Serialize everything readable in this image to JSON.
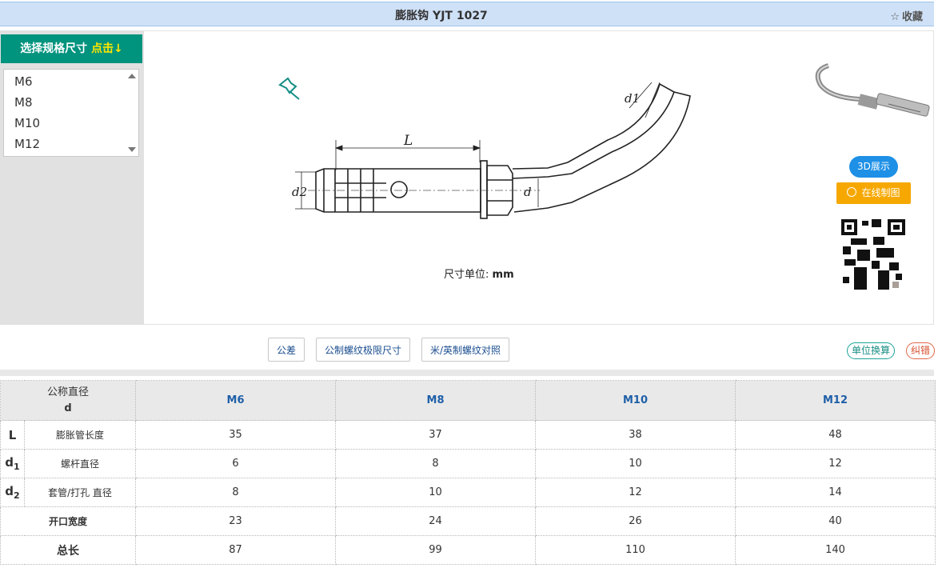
{
  "window": {
    "title": "膨胀钩 YJT 1027",
    "favorite_icon": "star-icon",
    "favorite_label": "收藏"
  },
  "sidebar": {
    "header_label": "选择规格尺寸",
    "header_highlight": "点击↓",
    "items": [
      "M6",
      "M8",
      "M10",
      "M12"
    ]
  },
  "figure": {
    "labels": {
      "L": "L",
      "d": "d",
      "d1": "d1",
      "d2": "d2"
    },
    "unit_caption_prefix": "尺寸单位:",
    "unit_caption_unit": "mm",
    "pin_icon": "pushpin-icon"
  },
  "right_panel": {
    "show3d_label": "3D展示",
    "online_draw_label": "在线制图",
    "online_draw_icon": "cad-icon"
  },
  "toolbar": {
    "tolerance_label": "公差",
    "thread_limits_label": "公制螺纹极限尺寸",
    "thread_compare_label": "米/英制螺纹对照",
    "unit_convert_label": "单位换算",
    "error_report_label": "纠错"
  },
  "table": {
    "header_name": "公称直径",
    "header_symbol": "d",
    "sizes": [
      "M6",
      "M8",
      "M10",
      "M12"
    ],
    "rows": [
      {
        "symbol": "L",
        "name": "膨胀管长度",
        "values": [
          "35",
          "37",
          "38",
          "48"
        ]
      },
      {
        "symbol": "d1",
        "name": "螺杆直径",
        "values": [
          "6",
          "8",
          "10",
          "12"
        ]
      },
      {
        "symbol": "d2",
        "name": "套管/打孔 直径",
        "values": [
          "8",
          "10",
          "12",
          "14"
        ]
      },
      {
        "symbol": "",
        "name": "开口宽度",
        "values": [
          "23",
          "24",
          "26",
          "40"
        ]
      },
      {
        "symbol": "",
        "name": "总长",
        "values": [
          "87",
          "99",
          "110",
          "140"
        ]
      }
    ]
  },
  "colors": {
    "title_bar": "#cfe1f7",
    "sidebar_header": "#00937e",
    "highlight": "#ffe600",
    "btn_3d": "#1e90e6",
    "btn_draw": "#f6a800",
    "size_header": "#1f5fa8"
  }
}
